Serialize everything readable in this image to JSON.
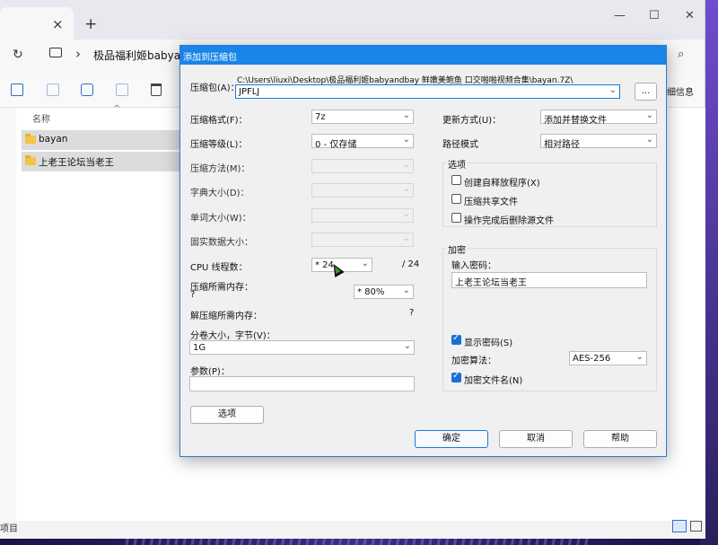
{
  "explorer": {
    "tab_close": "×",
    "tab_new": "+",
    "window_controls": {
      "minimize": "—",
      "maximize": "☐",
      "close": "✕"
    },
    "refresh": "↻",
    "breadcrumb_chevron": "›",
    "breadcrumb": "极品福利姬babyan",
    "search_icon": "⌕",
    "details_label": "细信息",
    "column_name": "名称",
    "sort_caret": "^",
    "files": [
      {
        "name": "bayan"
      },
      {
        "name": "上老王论坛当老王"
      }
    ],
    "status_text": "项目",
    "icons": [
      "copy-icon",
      "paste-icon",
      "rename-icon",
      "share-icon",
      "delete-icon"
    ]
  },
  "dialog": {
    "title": "添加到压缩包",
    "archive": {
      "label": "压缩包(A)：",
      "path": "C:\\Users\\liuxi\\Desktop\\极品福利姬babyandbay 鲜嫩美鲍鱼 口交啪啪视频合集\\bayan.7Z\\",
      "value": "JPFLJ",
      "browse_label": "..."
    },
    "format": {
      "label": "压缩格式(F)：",
      "value": "7z"
    },
    "level": {
      "label": "压缩等级(L)：",
      "value": "0 - 仅存储"
    },
    "method": {
      "label": "压缩方法(M)：",
      "value": ""
    },
    "dict_size": {
      "label": "字典大小(D)：",
      "value": ""
    },
    "word_size": {
      "label": "单词大小(W)：",
      "value": ""
    },
    "solid_size": {
      "label": "固实数据大小：",
      "value": ""
    },
    "cpu_threads": {
      "label": "CPU 线程数：",
      "value": "* 24",
      "total": "/ 24"
    },
    "mem_compress": {
      "label": "压缩所需内存：",
      "value": "?",
      "percent": "* 80%"
    },
    "mem_decompress": {
      "label": "解压缩所需内存：",
      "value": "?"
    },
    "split": {
      "label": "分卷大小，字节(V)：",
      "value": "1G"
    },
    "params": {
      "label": "参数(P)：",
      "value": ""
    },
    "options_button": "选项",
    "update_mode": {
      "label": "更新方式(U)：",
      "value": "添加并替换文件"
    },
    "path_mode": {
      "label": "路径模式",
      "value": "相对路径"
    },
    "options_group": {
      "title": "选项",
      "sfx": "创建自释放程序(X)",
      "shared": "压缩共享文件",
      "delete_after": "操作完成后删除源文件"
    },
    "encryption": {
      "title": "加密",
      "password_label": "输入密码：",
      "password": "上老王论坛当老王",
      "show_password": "显示密码(S)",
      "method_label": "加密算法：",
      "method_value": "AES-256",
      "encrypt_names": "加密文件名(N)"
    },
    "ok": "确定",
    "cancel": "取消",
    "help": "帮助",
    "dropdown_arrow": "⌄"
  }
}
